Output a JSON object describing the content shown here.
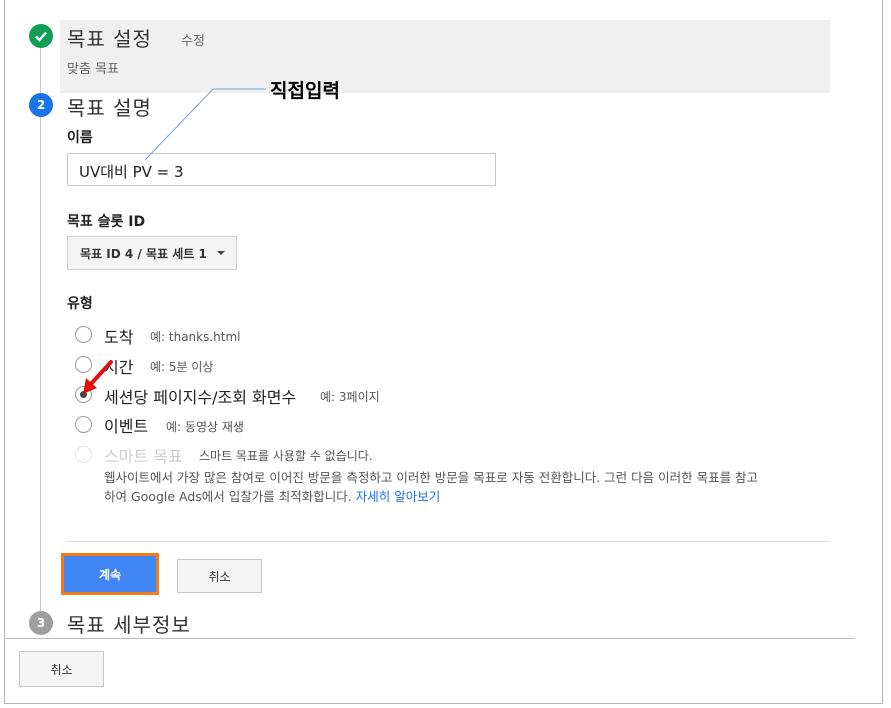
{
  "annotation": {
    "callout_text": "직접입력"
  },
  "step1": {
    "number": "✓",
    "title": "목표 설정",
    "edit_link": "수정",
    "subtitle": "맞춤 목표"
  },
  "step2": {
    "number": "2",
    "title": "목표 설명",
    "name_label": "이름",
    "name_value": "UV대비 PV = 3",
    "slot_label": "목표 슬롯 ID",
    "slot_value": "목표 ID 4 / 목표 세트 1",
    "type_label": "유형",
    "types": [
      {
        "label": "도착",
        "example": "예: thanks.html",
        "checked": false,
        "disabled": false
      },
      {
        "label": "시간",
        "example": "예: 5분 이상",
        "checked": false,
        "disabled": false
      },
      {
        "label": "세션당 페이지수/조회 화면수",
        "example": "예: 3페이지",
        "checked": true,
        "disabled": false
      },
      {
        "label": "이벤트",
        "example": "예: 동영상 재생",
        "checked": false,
        "disabled": false
      },
      {
        "label": "스마트 목표",
        "example": "스마트 목표를 사용할 수 없습니다.",
        "checked": false,
        "disabled": true
      }
    ],
    "smart_desc_line1": "웹사이트에서 가장 많은 참여로 이어진 방문을 측정하고 이러한 방문을 목표로 자동 전환합니다. 그런 다음 이러한 목표를 참고",
    "smart_desc_line2": "하여 Google Ads에서 입찰가를 최적화합니다.",
    "learn_more": "자세히 알아보기",
    "continue_button": "계속",
    "cancel_button": "취소"
  },
  "step3": {
    "number": "3",
    "title": "목표 세부정보"
  },
  "footer": {
    "cancel_button": "취소"
  },
  "colors": {
    "done_green": "#0f9d58",
    "active_blue": "#1a73e8",
    "continue_blue": "#4285f4",
    "highlight_orange": "#f07c1a",
    "arrow_red": "#e01010"
  }
}
